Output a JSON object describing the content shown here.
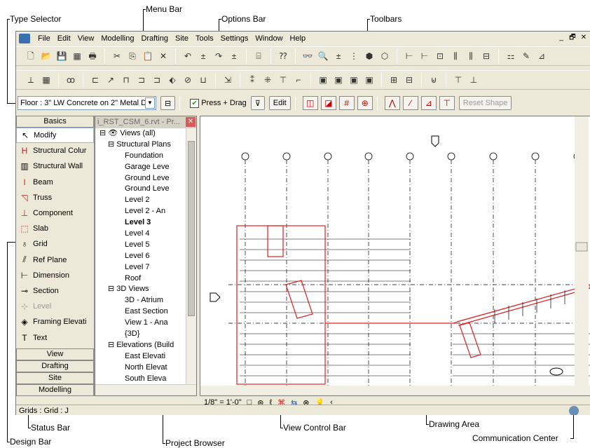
{
  "callouts": {
    "type_selector": "Type Selector",
    "menu_bar": "Menu Bar",
    "options_bar": "Options Bar",
    "toolbars": "Toolbars",
    "status_bar": "Status Bar",
    "design_bar": "Design Bar",
    "project_browser": "Project Browser",
    "view_control_bar": "View Control Bar",
    "drawing_area": "Drawing Area",
    "communication_center": "Communication Center"
  },
  "menu": [
    "File",
    "Edit",
    "View",
    "Modelling",
    "Drafting",
    "Site",
    "Tools",
    "Settings",
    "Window",
    "Help"
  ],
  "window_controls": [
    "_",
    "🗗",
    "✕"
  ],
  "toolbar1": [
    "🗋",
    "📂",
    "💾",
    "▦",
    "🖶",
    "|",
    "✂",
    "⎘",
    "📋",
    "✕",
    "|",
    "↶",
    "±",
    "↷",
    "±",
    "|",
    "⌸",
    "|",
    "⁇",
    "|",
    "👓",
    "🔍",
    "±",
    "⋮",
    "⬢",
    "⬡",
    "|",
    "⊢",
    "⊢",
    "⊡",
    "⫼",
    "⫼",
    "⊟",
    "|",
    "⚏",
    "✎",
    "⊿"
  ],
  "toolbar2": [
    "⟂",
    "▦",
    "|",
    "ꝏ",
    "|",
    "⊏",
    "↗",
    "⊓",
    "⊐",
    "⊐",
    "⬖",
    "⊘",
    "⊔",
    "|",
    "⇲",
    "|",
    "⁑",
    "⁜",
    "⊤",
    "⌐",
    "|",
    "▣",
    "▣",
    "▣",
    "▣",
    "|",
    "⊞",
    "⊟",
    "|",
    "⊌",
    "|",
    "⊤",
    "⊥"
  ],
  "options": {
    "type_value": "Floor : 3\" LW Concrete on 2\" Metal D",
    "press_drag": "Press + Drag",
    "edit": "Edit",
    "reset_shape": "Reset Shape"
  },
  "design_bar": {
    "basics_tab": "Basics",
    "items": [
      {
        "icon": "↖",
        "label": "Modify"
      },
      {
        "icon": "H",
        "label": "Structural Colur"
      },
      {
        "icon": "▥",
        "label": "Structural Wall"
      },
      {
        "icon": "I",
        "label": "Beam"
      },
      {
        "icon": "◹",
        "label": "Truss"
      },
      {
        "icon": "⊥",
        "label": "Component"
      },
      {
        "icon": "⬚",
        "label": "Slab"
      },
      {
        "icon": "♁",
        "label": "Grid"
      },
      {
        "icon": "⫽",
        "label": "Ref Plane"
      },
      {
        "icon": "⊢",
        "label": "Dimension"
      },
      {
        "icon": "⊸",
        "label": "Section"
      },
      {
        "icon": "⊹",
        "label": "Level"
      },
      {
        "icon": "◈",
        "label": "Framing Elevati"
      },
      {
        "icon": "T",
        "label": "Text"
      }
    ],
    "bottom_tabs": [
      "View",
      "Drafting",
      "Site",
      "Modelling"
    ]
  },
  "browser": {
    "title": "i_RST_CSM_6.rvt - Pr...",
    "close": "✕",
    "rows": [
      {
        "indent": 0,
        "text": "⊟ 👁 Views (all)",
        "bold": false
      },
      {
        "indent": 1,
        "text": "⊟ Structural Plans",
        "bold": false
      },
      {
        "indent": 3,
        "text": "Foundation",
        "bold": false
      },
      {
        "indent": 3,
        "text": "Garage Leve",
        "bold": false
      },
      {
        "indent": 3,
        "text": "Ground Leve",
        "bold": false
      },
      {
        "indent": 3,
        "text": "Ground Leve",
        "bold": false
      },
      {
        "indent": 3,
        "text": "Level 2",
        "bold": false
      },
      {
        "indent": 3,
        "text": "Level 2 - An",
        "bold": false
      },
      {
        "indent": 3,
        "text": "Level 3",
        "bold": true
      },
      {
        "indent": 3,
        "text": "Level 4",
        "bold": false
      },
      {
        "indent": 3,
        "text": "Level 5",
        "bold": false
      },
      {
        "indent": 3,
        "text": "Level 6",
        "bold": false
      },
      {
        "indent": 3,
        "text": "Level 7",
        "bold": false
      },
      {
        "indent": 3,
        "text": "Roof",
        "bold": false
      },
      {
        "indent": 1,
        "text": "⊟ 3D Views",
        "bold": false
      },
      {
        "indent": 3,
        "text": "3D - Atrium",
        "bold": false
      },
      {
        "indent": 3,
        "text": "East Section",
        "bold": false
      },
      {
        "indent": 3,
        "text": "View 1 - Ana",
        "bold": false
      },
      {
        "indent": 3,
        "text": "{3D}",
        "bold": false
      },
      {
        "indent": 1,
        "text": "⊟ Elevations (Build",
        "bold": false
      },
      {
        "indent": 3,
        "text": "East Elevati",
        "bold": false
      },
      {
        "indent": 3,
        "text": "North Elevat",
        "bold": false
      },
      {
        "indent": 3,
        "text": "South Eleva",
        "bold": false
      }
    ]
  },
  "view_control": {
    "scale": "1/8\" = 1'-0\"",
    "icons": [
      "□",
      "⊛",
      "ℓ",
      "⌘",
      "⇆",
      "⊗",
      "💡",
      "‹"
    ]
  },
  "status": {
    "text": "Grids : Grid : J"
  },
  "colors": {
    "chrome": "#ece9d8",
    "red_line": "#e02020",
    "selection": "#9cb2d8"
  }
}
